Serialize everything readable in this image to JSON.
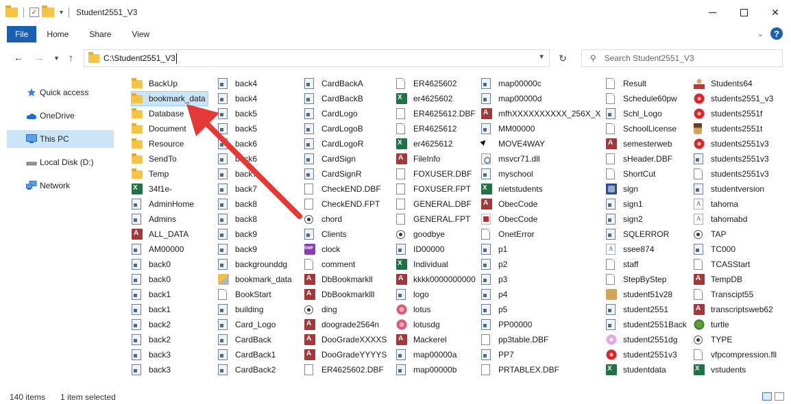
{
  "window": {
    "title": "Student2551_V3",
    "minimize": "–",
    "close": "✕"
  },
  "ribbon": {
    "tabs": [
      "File",
      "Home",
      "Share",
      "View"
    ]
  },
  "address": {
    "path": "C:\\Student2551_V3"
  },
  "search": {
    "placeholder": "Search Student2551_V3"
  },
  "nav": {
    "items": [
      {
        "label": "Quick access",
        "icon": "star-icon"
      },
      {
        "label": "OneDrive",
        "icon": "cloud-icon"
      },
      {
        "label": "This PC",
        "icon": "monitor-icon",
        "selected": true
      },
      {
        "label": "Local Disk (D:)",
        "icon": "drive-icon"
      },
      {
        "label": "Network",
        "icon": "network-icon"
      }
    ]
  },
  "files": {
    "columns": [
      [
        {
          "name": "BackUp",
          "icon": "folder"
        },
        {
          "name": "bookmark_data",
          "icon": "folder",
          "selected": true
        },
        {
          "name": "Database",
          "icon": "folder"
        },
        {
          "name": "Document",
          "icon": "folder"
        },
        {
          "name": "Resource",
          "icon": "folder"
        },
        {
          "name": "SendTo",
          "icon": "folder"
        },
        {
          "name": "Temp",
          "icon": "folder"
        },
        {
          "name": "34f1e-",
          "icon": "excel"
        },
        {
          "name": "AdminHome",
          "icon": "prog"
        },
        {
          "name": "Admins",
          "icon": "prog"
        },
        {
          "name": "ALL_DATA",
          "icon": "access"
        },
        {
          "name": "AM00000",
          "icon": "prog"
        },
        {
          "name": "back0",
          "icon": "prog"
        },
        {
          "name": "back0",
          "icon": "prog"
        },
        {
          "name": "back1",
          "icon": "prog"
        },
        {
          "name": "back1",
          "icon": "prog"
        },
        {
          "name": "back2",
          "icon": "prog"
        },
        {
          "name": "back2",
          "icon": "prog"
        },
        {
          "name": "back3",
          "icon": "prog"
        },
        {
          "name": "back3",
          "icon": "prog"
        }
      ],
      [
        {
          "name": "back4",
          "icon": "prog"
        },
        {
          "name": "back4",
          "icon": "prog"
        },
        {
          "name": "back5",
          "icon": "prog"
        },
        {
          "name": "back5",
          "icon": "prog"
        },
        {
          "name": "back6",
          "icon": "prog"
        },
        {
          "name": "back6",
          "icon": "prog"
        },
        {
          "name": "back7",
          "icon": "prog"
        },
        {
          "name": "back7",
          "icon": "prog"
        },
        {
          "name": "back8",
          "icon": "prog"
        },
        {
          "name": "back8",
          "icon": "prog"
        },
        {
          "name": "back9",
          "icon": "prog"
        },
        {
          "name": "back9",
          "icon": "prog"
        },
        {
          "name": "backgrounddg",
          "icon": "prog"
        },
        {
          "name": "bookmark_data",
          "icon": "bookmark"
        },
        {
          "name": "BookStart",
          "icon": "file"
        },
        {
          "name": "building",
          "icon": "prog"
        },
        {
          "name": "Card_Logo",
          "icon": "prog"
        },
        {
          "name": "CardBack",
          "icon": "prog"
        },
        {
          "name": "CardBack1",
          "icon": "prog"
        },
        {
          "name": "CardBack2",
          "icon": "prog"
        }
      ],
      [
        {
          "name": "CardBackA",
          "icon": "prog"
        },
        {
          "name": "CardBackB",
          "icon": "prog"
        },
        {
          "name": "CardLogo",
          "icon": "prog"
        },
        {
          "name": "CardLogoB",
          "icon": "prog"
        },
        {
          "name": "CardLogoR",
          "icon": "prog"
        },
        {
          "name": "CardSign",
          "icon": "prog"
        },
        {
          "name": "CardSignR",
          "icon": "prog"
        },
        {
          "name": "CheckEND.DBF",
          "icon": "dbf"
        },
        {
          "name": "CheckEND.FPT",
          "icon": "dbf"
        },
        {
          "name": "chord",
          "icon": "circle"
        },
        {
          "name": "Clients",
          "icon": "prog"
        },
        {
          "name": "clock",
          "icon": "swf"
        },
        {
          "name": "comment",
          "icon": "file"
        },
        {
          "name": "DbBookmarkll",
          "icon": "access"
        },
        {
          "name": "DbBookmarklll",
          "icon": "access"
        },
        {
          "name": "ding",
          "icon": "circle"
        },
        {
          "name": "doograde2564n",
          "icon": "access"
        },
        {
          "name": "DooGradeXXXXS",
          "icon": "access"
        },
        {
          "name": "DooGradeYYYYS",
          "icon": "access"
        },
        {
          "name": "ER4625602.DBF",
          "icon": "dbf"
        }
      ],
      [
        {
          "name": "ER4625602",
          "icon": "file"
        },
        {
          "name": "er4625602",
          "icon": "excel"
        },
        {
          "name": "ER4625612.DBF",
          "icon": "dbf"
        },
        {
          "name": "ER4625612",
          "icon": "file"
        },
        {
          "name": "er4625612",
          "icon": "excel"
        },
        {
          "name": "FileInfo",
          "icon": "access"
        },
        {
          "name": "FOXUSER.DBF",
          "icon": "dbf"
        },
        {
          "name": "FOXUSER.FPT",
          "icon": "dbf"
        },
        {
          "name": "GENERAL.DBF",
          "icon": "dbf"
        },
        {
          "name": "GENERAL.FPT",
          "icon": "dbf"
        },
        {
          "name": "goodbye",
          "icon": "circle"
        },
        {
          "name": "ID00000",
          "icon": "prog"
        },
        {
          "name": "Individual",
          "icon": "excel"
        },
        {
          "name": "kkkk0000000000",
          "icon": "access"
        },
        {
          "name": "logo",
          "icon": "prog"
        },
        {
          "name": "lotus",
          "icon": "flower"
        },
        {
          "name": "lotusdg",
          "icon": "flower"
        },
        {
          "name": "Mackerel",
          "icon": "access"
        },
        {
          "name": "map00000a",
          "icon": "prog"
        },
        {
          "name": "map00000b",
          "icon": "prog"
        }
      ],
      [
        {
          "name": "map00000c",
          "icon": "prog"
        },
        {
          "name": "map00000d",
          "icon": "prog"
        },
        {
          "name": "mfhXXXXXXXXXX_256X_X",
          "icon": "access"
        },
        {
          "name": "MM00000",
          "icon": "prog"
        },
        {
          "name": "MOVE4WAY",
          "icon": "cursor"
        },
        {
          "name": "msvcr71.dll",
          "icon": "dll"
        },
        {
          "name": "myschool",
          "icon": "prog"
        },
        {
          "name": "nietstudents",
          "icon": "excel"
        },
        {
          "name": "ObecCode",
          "icon": "access"
        },
        {
          "name": "ObecCode",
          "icon": "acrobat"
        },
        {
          "name": "OnetError",
          "icon": "file"
        },
        {
          "name": "p1",
          "icon": "prog"
        },
        {
          "name": "p2",
          "icon": "prog"
        },
        {
          "name": "p3",
          "icon": "prog"
        },
        {
          "name": "p4",
          "icon": "prog"
        },
        {
          "name": "p5",
          "icon": "prog"
        },
        {
          "name": "PP00000",
          "icon": "prog"
        },
        {
          "name": "pp3table.DBF",
          "icon": "dbf"
        },
        {
          "name": "PP7",
          "icon": "prog"
        },
        {
          "name": "PRTABLEX.DBF",
          "icon": "dbf"
        }
      ],
      [
        {
          "name": "Result",
          "icon": "file"
        },
        {
          "name": "Schedule60pw",
          "icon": "file"
        },
        {
          "name": "Schl_Logo",
          "icon": "prog"
        },
        {
          "name": "SchoolLicense",
          "icon": "file"
        },
        {
          "name": "semesterweb",
          "icon": "access"
        },
        {
          "name": "sHeader.DBF",
          "icon": "dbf"
        },
        {
          "name": "ShortCut",
          "icon": "file"
        },
        {
          "name": "sign",
          "icon": "sign"
        },
        {
          "name": "sign1",
          "icon": "prog"
        },
        {
          "name": "sign2",
          "icon": "prog"
        },
        {
          "name": "SQLERROR",
          "icon": "prog"
        },
        {
          "name": "ssee874",
          "icon": "font"
        },
        {
          "name": "staff",
          "icon": "file"
        },
        {
          "name": "StepByStep",
          "icon": "file"
        },
        {
          "name": "student51v28",
          "icon": "box"
        },
        {
          "name": "student2551",
          "icon": "prog"
        },
        {
          "name": "student2551Back",
          "icon": "prog"
        },
        {
          "name": "student2551dg",
          "icon": "pinkflower"
        },
        {
          "name": "student2551v3",
          "icon": "redflower"
        },
        {
          "name": "studentdata",
          "icon": "excel"
        }
      ],
      [
        {
          "name": "Students64",
          "icon": "person"
        },
        {
          "name": "students2551_v3",
          "icon": "redflower"
        },
        {
          "name": "students2551f",
          "icon": "redflower"
        },
        {
          "name": "students2551t",
          "icon": "cup"
        },
        {
          "name": "students2551v3",
          "icon": "redflower"
        },
        {
          "name": "students2551v3",
          "icon": "prog"
        },
        {
          "name": "students2551v3",
          "icon": "file"
        },
        {
          "name": "studentversion",
          "icon": "prog"
        },
        {
          "name": "tahoma",
          "icon": "font"
        },
        {
          "name": "tahomabd",
          "icon": "font"
        },
        {
          "name": "TAP",
          "icon": "circle"
        },
        {
          "name": "TC000",
          "icon": "prog"
        },
        {
          "name": "TCASStart",
          "icon": "file"
        },
        {
          "name": "TempDB",
          "icon": "access"
        },
        {
          "name": "Transcipt55",
          "icon": "file"
        },
        {
          "name": "transcriptsweb62",
          "icon": "access"
        },
        {
          "name": "turtle",
          "icon": "turtle"
        },
        {
          "name": "TYPE",
          "icon": "circle"
        },
        {
          "name": "vfpcompression.fll",
          "icon": "file"
        },
        {
          "name": "vstudents",
          "icon": "excel"
        }
      ]
    ]
  },
  "status": {
    "count": "140 items",
    "selection": "1 item selected"
  },
  "annotation": {
    "arrow_color": "#e53935"
  }
}
